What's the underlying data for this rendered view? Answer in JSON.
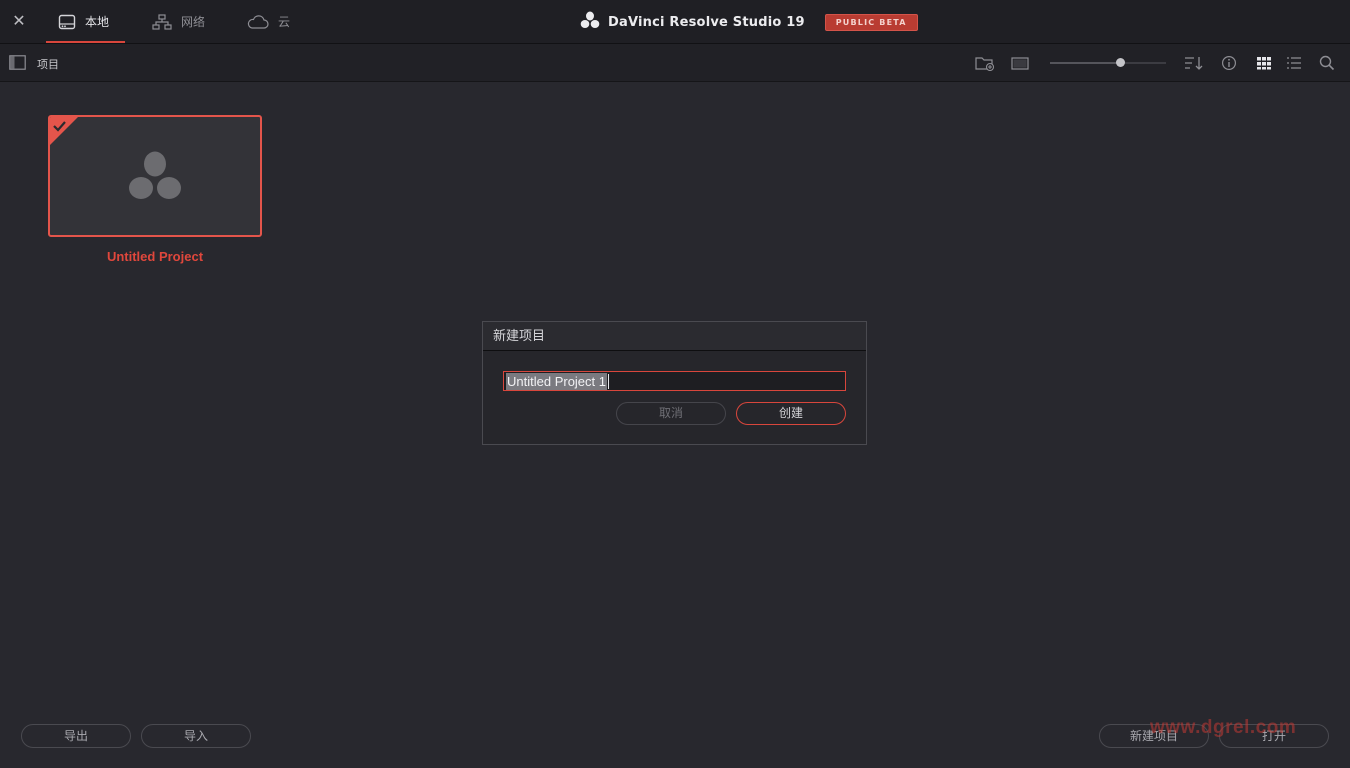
{
  "titlebar": {
    "tabs": [
      {
        "label": "本地",
        "icon": "drive-icon",
        "active": true
      },
      {
        "label": "网络",
        "icon": "network-icon",
        "active": false
      },
      {
        "label": "云",
        "icon": "cloud-icon",
        "active": false
      }
    ],
    "app_name": "DaVinci Resolve Studio 19",
    "beta_badge": "PUBLIC BETA"
  },
  "toolbar": {
    "title": "项目",
    "zoom_level": 0.6
  },
  "projects": [
    {
      "name": "Untitled Project",
      "selected": true
    }
  ],
  "dialog": {
    "title": "新建项目",
    "input_value": "Untitled Project 1",
    "cancel_label": "取消",
    "create_label": "创建"
  },
  "footer": {
    "export_label": "导出",
    "import_label": "导入",
    "new_project_label": "新建项目",
    "open_label": "打开"
  },
  "watermark": "www.dgrel.com",
  "colors": {
    "accent": "#d8463c",
    "background": "#28282e",
    "titlebar": "#1f1f24"
  }
}
